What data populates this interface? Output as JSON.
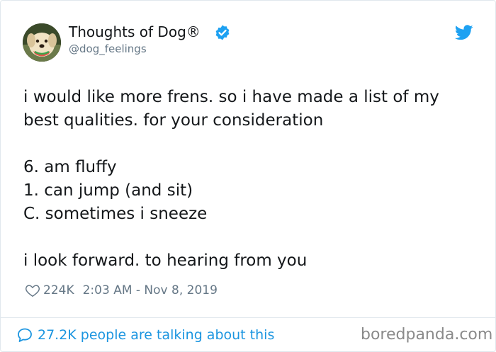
{
  "user": {
    "display_name": "Thoughts of Dog®",
    "handle": "@dog_feelings",
    "verified": true
  },
  "tweet": {
    "paragraphs": [
      [
        "i would like more frens. so i have made a list of my best qualities. for your consideration"
      ],
      [
        "6. am fluffy",
        "1. can jump (and sit)",
        "C. sometimes i sneeze"
      ],
      [
        "i look forward. to hearing from you"
      ]
    ],
    "likes": "224K",
    "timestamp": "2:03 AM - Nov 8, 2019"
  },
  "footer": {
    "talking_text": "27.2K people are talking about this"
  },
  "watermark": "boredpanda.com",
  "icons": {
    "verified": "verified-badge-icon",
    "bird": "twitter-bird-icon",
    "heart": "heart-icon",
    "reply": "speech-bubble-icon"
  },
  "colors": {
    "twitter_blue": "#1da1f2",
    "link_blue": "#1b95e0",
    "muted_text": "#657786",
    "main_text": "#14171a"
  }
}
